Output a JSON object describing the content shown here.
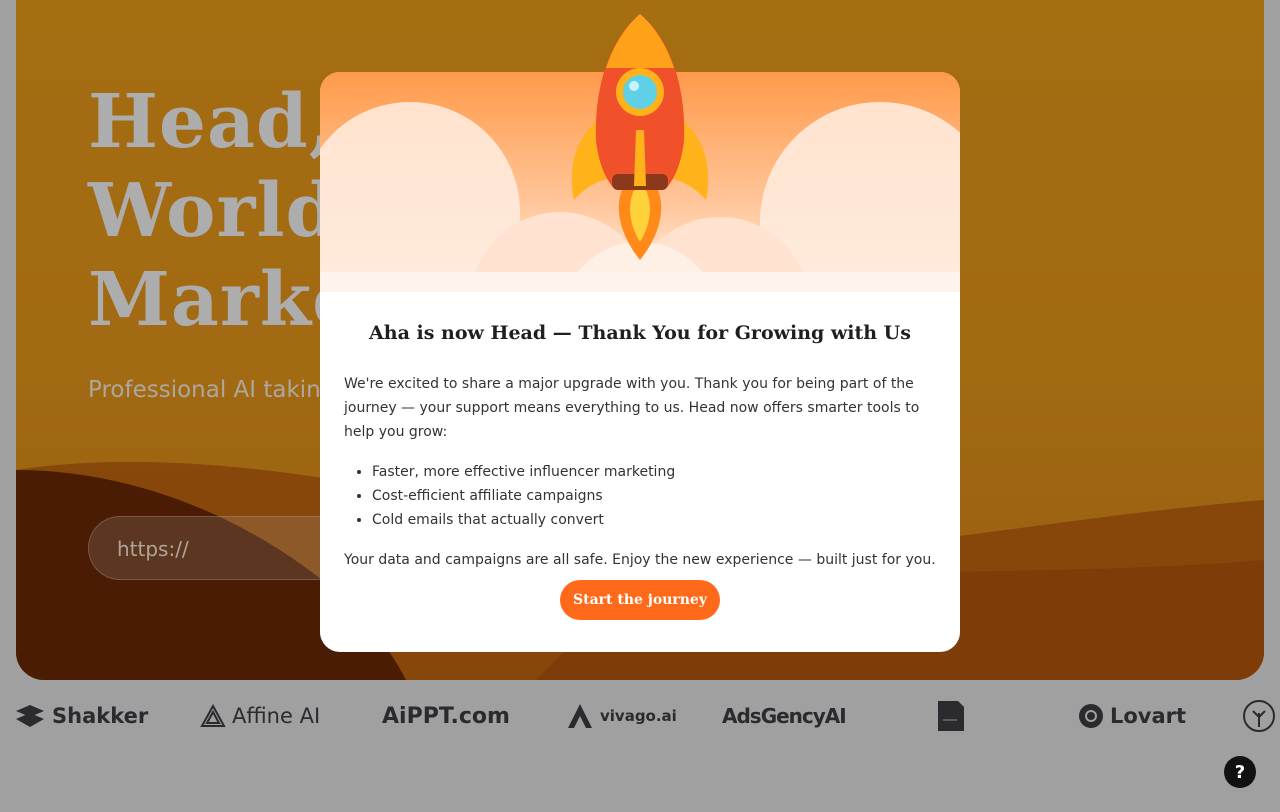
{
  "hero": {
    "title_lines": [
      "Head,",
      "World",
      "Marke"
    ],
    "subtitle": "Professional AI takin marketing.",
    "url_placeholder": "https://"
  },
  "logos": [
    {
      "name": "Shakker",
      "icon": "shakker-logo-icon"
    },
    {
      "name": "Affine AI",
      "icon": "affine-logo-icon"
    },
    {
      "name": "AiPPT.com",
      "icon": "aippt-logo"
    },
    {
      "name": "vivago.ai",
      "icon": "vivago-logo-icon"
    },
    {
      "name": "AdsGencyAI",
      "icon": "adsgency-logo"
    },
    {
      "name": "",
      "icon": "document-logo-icon"
    },
    {
      "name": "Lovart",
      "icon": "lovart-logo-icon"
    },
    {
      "name": "",
      "icon": "tree-logo-icon"
    }
  ],
  "modal": {
    "title": "Aha is now Head — Thank You for Growing with Us",
    "intro": "We're excited to share a major upgrade with you. Thank you for being part of the journey — your support means everything to us. Head now offers smarter tools to help you grow:",
    "bullets": [
      "Faster, more effective influencer marketing",
      "Cost-efficient affiliate campaigns",
      "Cold emails that actually convert"
    ],
    "closing": "Your data and campaigns are all safe. Enjoy the new experience — built just for you.",
    "cta_label": "Start the journey"
  },
  "help_label": "?",
  "colors": {
    "hero_orange": "#f2a21a",
    "cta_orange": "#ff6a1a",
    "rocket_red": "#f0502a",
    "overlay": "rgba(0,0,0,0.32)"
  }
}
